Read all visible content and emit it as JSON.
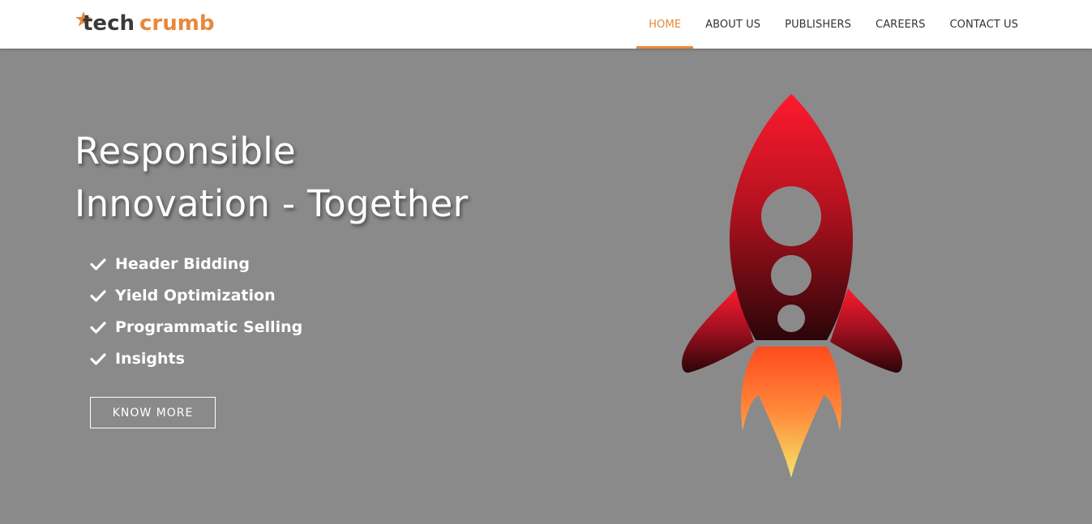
{
  "brand": {
    "logo_text": "techcrumb",
    "accent_color": "#e8883a",
    "logo_dark_color": "#3a3a3a"
  },
  "nav": {
    "items": [
      {
        "label": "HOME",
        "active": true
      },
      {
        "label": "ABOUT US",
        "active": false
      },
      {
        "label": "PUBLISHERS",
        "active": false
      },
      {
        "label": "CAREERS",
        "active": false
      },
      {
        "label": "CONTACT US",
        "active": false
      }
    ]
  },
  "hero": {
    "title_line1": "Responsible",
    "title_line2": "Innovation - Together",
    "features": [
      {
        "icon": "check-icon",
        "label": "Header Bidding"
      },
      {
        "icon": "check-icon",
        "label": "Yield Optimization"
      },
      {
        "icon": "check-icon",
        "label": "Programmatic Selling"
      },
      {
        "icon": "check-icon",
        "label": "Insights"
      }
    ],
    "cta_label": "KNOW MORE",
    "background_color": "#8a8a8a",
    "illustration": "rocket-icon"
  }
}
